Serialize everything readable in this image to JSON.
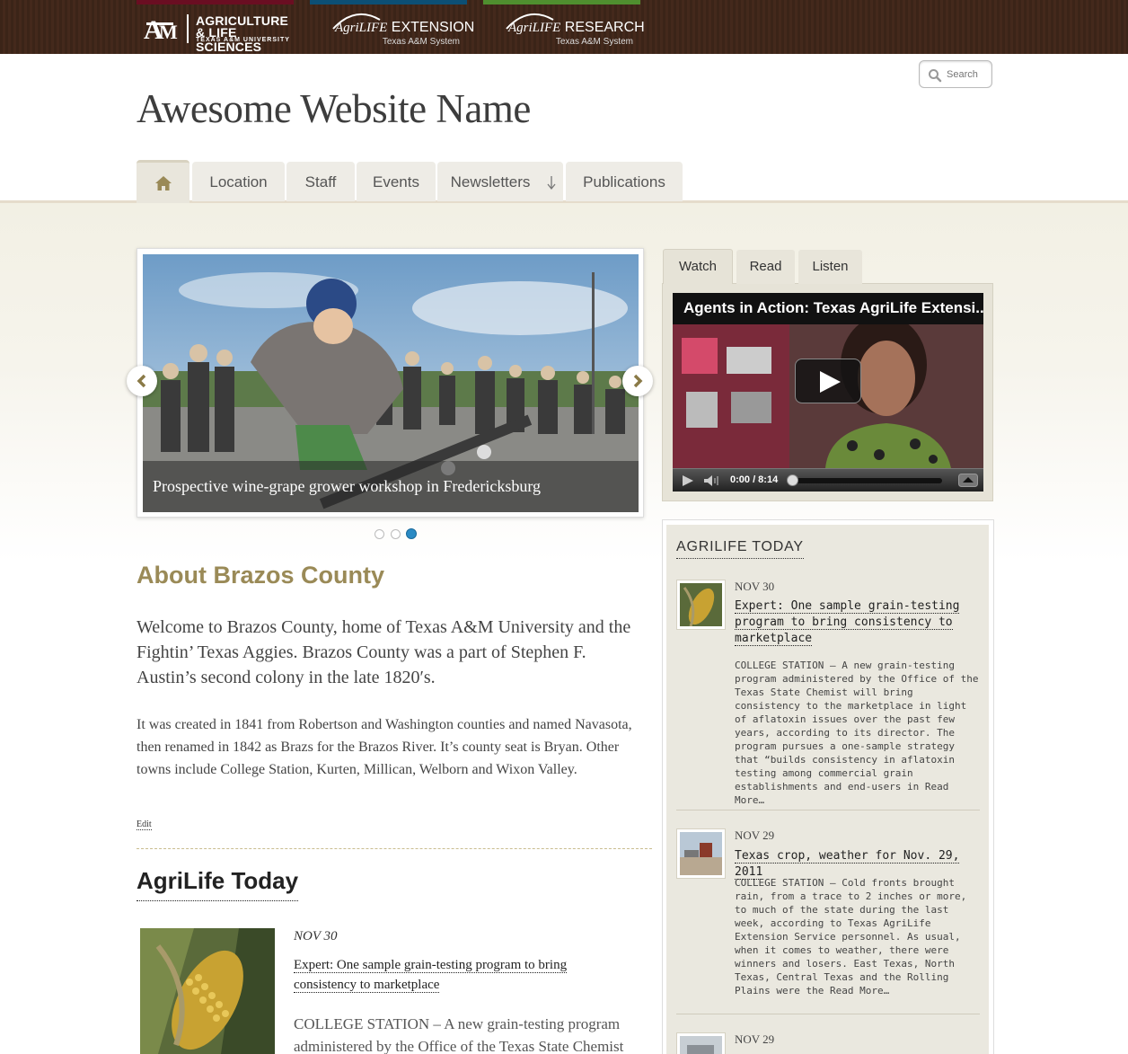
{
  "brands": [
    {
      "name": "AGRICULTURE",
      "name2": "& LIFE SCIENCES",
      "sub": "TEXAS A&M UNIVERSITY",
      "stripe": "#5c0a1a"
    },
    {
      "name": "AgriLIFE",
      "name_suffix": "EXTENSION",
      "sub": "Texas A&M System",
      "stripe": "#0c4f75"
    },
    {
      "name": "AgriLIFE",
      "name_suffix": "RESEARCH",
      "sub": "Texas A&M System",
      "stripe": "#4f8f2f"
    }
  ],
  "search": {
    "placeholder": "Search"
  },
  "site_title": "Awesome Website Name",
  "nav": [
    "Location",
    "Staff",
    "Events",
    "Newsletters",
    "Publications"
  ],
  "slider": {
    "caption": "Prospective wine-grape grower workshop in Fredericksburg",
    "slide_count": 3,
    "active_slide": 3
  },
  "media_tabs": {
    "watch": "Watch",
    "read": "Read",
    "listen": "Listen",
    "active": "Watch"
  },
  "video": {
    "title": "Agents in Action: Texas AgriLife Extensi...",
    "time": "0:00 / 8:14"
  },
  "about": {
    "title": "About Brazos County",
    "lead": "Welcome to Brazos County, home of Texas A&M University and the Fightin’ Texas Aggies. Brazos County was a part of Stephen F. Austin’s second colony in the late 1820′s.",
    "body": "It was created in 1841 from Robertson and Washington counties and named Navasota, then renamed in 1842 as Brazs for the Brazos River. It’s county seat is Bryan. Other towns include College Station, Kurten, Millican, Welborn and Wixon Valley.",
    "edit": "Edit"
  },
  "agrilife_today": {
    "title": "AgriLife Today",
    "date": "NOV 30",
    "headline": "Expert: One sample grain-testing program to bring consistency to marketplace",
    "excerpt": "COLLEGE STATION – A new grain-testing program administered by the Office of the Texas State Chemist"
  },
  "sidebar": {
    "title": "AGRILIFE TODAY",
    "items": [
      {
        "date": "NOV 30",
        "headline": "Expert: One sample grain-testing program to bring consistency to marketplace",
        "excerpt": "COLLEGE STATION – A new grain-testing program administered by the Office of the Texas State Chemist will bring consistency to the marketplace in light of aflatoxin issues over the past few years, according to its director. The program pursues a one-sample strategy that “builds consistency in aflatoxin testing among commercial grain establishments and end-users in Read More…"
      },
      {
        "date": "NOV 29",
        "headline": "Texas crop, weather for Nov. 29, 2011",
        "excerpt": "COLLEGE STATION – Cold fronts brought rain, from a trace to 2 inches or more, to much of the state during the last week, according to Texas AgriLife Extension Service personnel. As usual, when it comes to weather, there were winners and losers. East Texas, North Texas, Central Texas and the Rolling Plains were the Read More…"
      },
      {
        "date": "NOV 29"
      }
    ]
  }
}
